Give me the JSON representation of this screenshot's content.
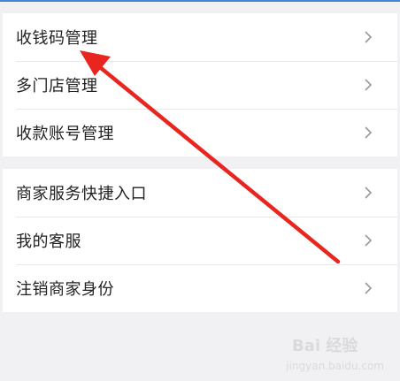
{
  "menu": {
    "group1": [
      {
        "label": "收钱码管理"
      },
      {
        "label": "多门店管理"
      },
      {
        "label": "收款账号管理"
      }
    ],
    "group2": [
      {
        "label": "商家服务快捷入口"
      },
      {
        "label": "我的客服"
      },
      {
        "label": "注销商家身份"
      }
    ]
  },
  "icons": {
    "row_chevron": "chevron-right-icon"
  },
  "annotation": {
    "arrow_color": "#e8251f"
  },
  "watermark": {
    "brand": "Bai 经验",
    "domain": "jingyan.baidu.com"
  },
  "colors": {
    "top_accent": "#3f86d6",
    "background": "#f1f1f3"
  }
}
